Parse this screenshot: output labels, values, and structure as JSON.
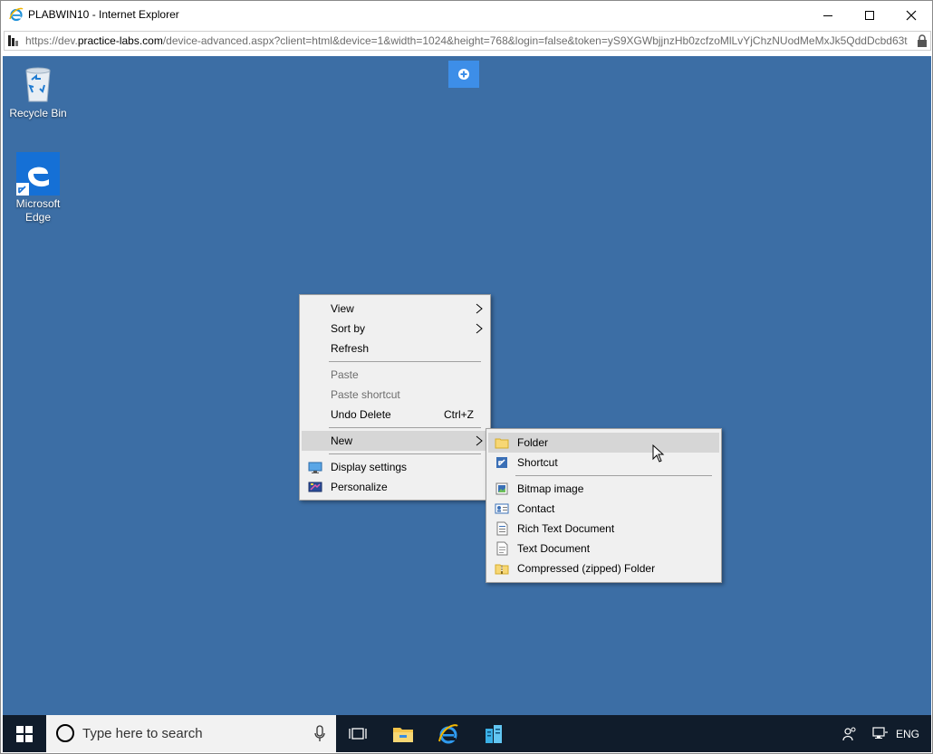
{
  "window": {
    "title": "PLABWIN10 - Internet Explorer",
    "url_prefix": "https://dev.",
    "url_host": "practice-labs.com",
    "url_rest": "/device-advanced.aspx?client=html&device=1&width=1024&height=768&login=false&token=yS9XGWbjjnzHb0zcfzoMlLvYjChzNUodMeMxJk5QddDcbd63t"
  },
  "desktop": {
    "icons": [
      {
        "label": "Recycle Bin",
        "icon": "recycle-bin-icon"
      },
      {
        "label_line1": "Microsoft",
        "label_line2": "Edge",
        "icon": "edge-icon"
      }
    ],
    "background_color": "#3c6ea5"
  },
  "context_menu": {
    "items": [
      {
        "label": "View",
        "submenu": true
      },
      {
        "label": "Sort by",
        "submenu": true
      },
      {
        "label": "Refresh"
      },
      {
        "label": "Paste",
        "disabled": true
      },
      {
        "label": "Paste shortcut",
        "disabled": true
      },
      {
        "label": "Undo Delete",
        "shortcut": "Ctrl+Z"
      },
      {
        "label": "New",
        "submenu": true,
        "highlighted": true
      },
      {
        "label": "Display settings",
        "icon": "display-settings-icon"
      },
      {
        "label": "Personalize",
        "icon": "personalize-icon"
      }
    ]
  },
  "new_submenu": {
    "items": [
      {
        "label": "Folder",
        "icon": "folder-icon",
        "highlighted": true
      },
      {
        "label": "Shortcut",
        "icon": "shortcut-icon"
      },
      {
        "label": "Bitmap image",
        "icon": "bitmap-icon"
      },
      {
        "label": "Contact",
        "icon": "contact-icon"
      },
      {
        "label": "Rich Text Document",
        "icon": "rich-text-icon"
      },
      {
        "label": "Text Document",
        "icon": "text-document-icon"
      },
      {
        "label": "Compressed (zipped) Folder",
        "icon": "zip-folder-icon"
      }
    ]
  },
  "taskbar": {
    "search_placeholder": "Type here to search",
    "language": "ENG"
  }
}
